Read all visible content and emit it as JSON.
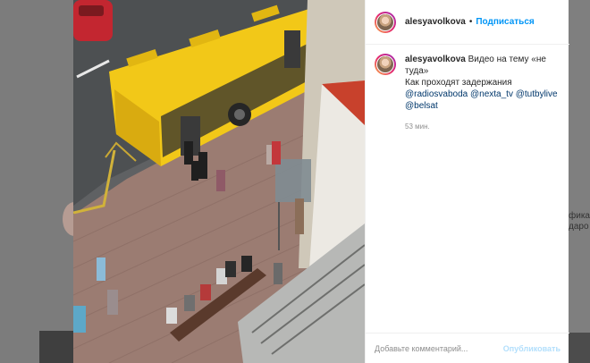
{
  "post": {
    "username": "alesyavolkova",
    "separator": "•",
    "follow_label": "Подписаться",
    "caption_username": "alesyavolkova",
    "caption_lines": [
      "Видео на тему «не",
      "туда»",
      "Как проходят задержания"
    ],
    "mentions_line1": [
      "@radiosvaboda",
      "@nexta_tv",
      "@tutbylive"
    ],
    "mentions_line2": [
      "@belsat"
    ],
    "timestamp": "53 мин.",
    "comment_placeholder": "Добавьте комментарий...",
    "publish_label": "Опубликовать"
  },
  "background": {
    "right_edge_text": "фика\nдаро"
  },
  "colors": {
    "accent_blue": "#0095f6",
    "publish_disabled": "#b2dffc",
    "mention": "#00376b",
    "bus_yellow": "#f2c818"
  }
}
